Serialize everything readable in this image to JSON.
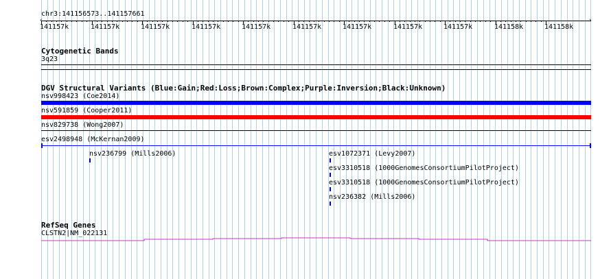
{
  "colors": {
    "grid": "#aad4e6",
    "blue": "#0000ff",
    "red": "#ff0000",
    "refseq": "#cc33cc"
  },
  "ruler": {
    "location": "chr3:141156573..141157661",
    "tick_labels": [
      "141157k",
      "141157k",
      "141157k",
      "141157k",
      "141157k",
      "141157k",
      "141157k",
      "141157k",
      "141157k",
      "141158k",
      "141158k"
    ]
  },
  "cytobands": {
    "title": "Cytogenetic Bands",
    "band": "3q23"
  },
  "dgv": {
    "title": "DGV Structural Variants (Blue:Gain;Red:Loss;Brown:Complex;Purple:Inversion;Black:Unknown)",
    "tracks": [
      {
        "label": "nsv998423 (Coe2014)",
        "color": "blue"
      },
      {
        "label": "nsv591859 (Cooper2011)",
        "color": "red"
      },
      {
        "label": "nsv829738 (Wong2007)",
        "color": "black"
      },
      {
        "label": "esv2498948 (McKernan2009)",
        "color": "blue-thin"
      }
    ],
    "small_features": [
      {
        "label": "nsv236799 (Mills2006)"
      },
      {
        "label": "esv1072371 (Levy2007)"
      },
      {
        "label": "esv3310518 (1000GenomesConsortiumPilotProject)"
      },
      {
        "label": "esv3310518 (1000GenomesConsortiumPilotProject)"
      },
      {
        "label": "nsv236382 (Mills2006)"
      }
    ]
  },
  "refseq": {
    "title": "RefSeq Genes",
    "gene": "CLSTN2|NM_022131"
  }
}
